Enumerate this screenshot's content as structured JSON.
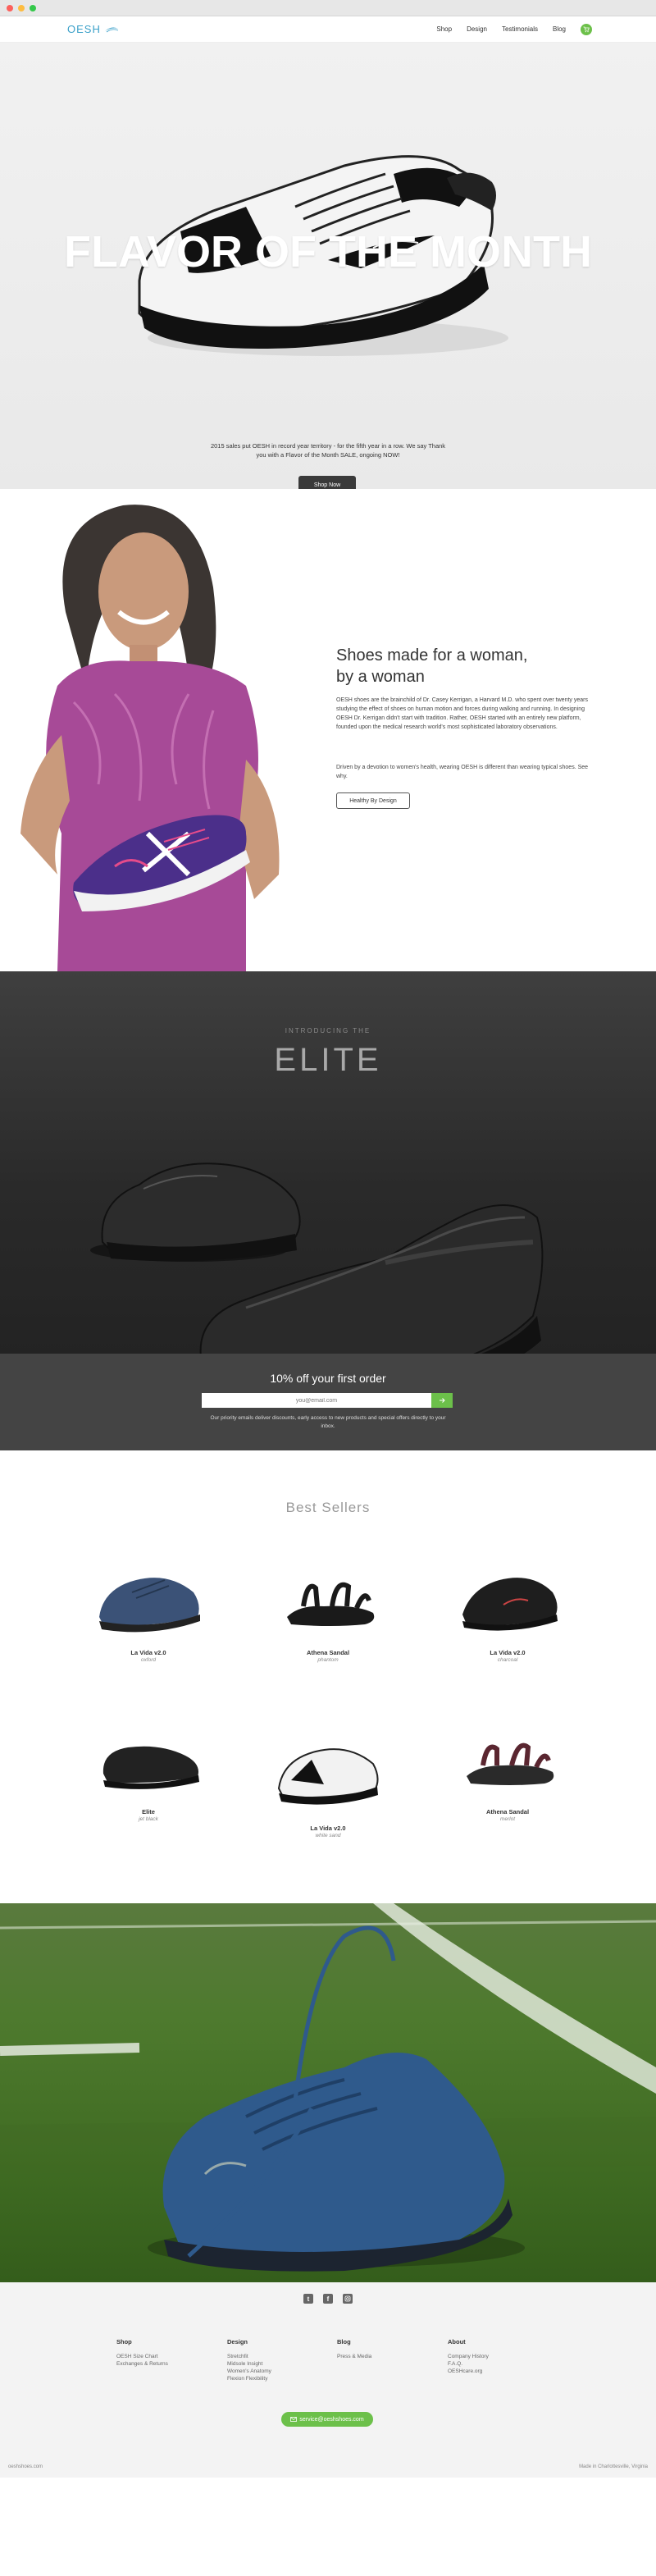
{
  "nav": {
    "logo": "OESH",
    "links": [
      "Shop",
      "Design",
      "Testimonials",
      "Blog"
    ]
  },
  "hero": {
    "title": "FLAVOR OF THE MONTH",
    "text_line1": "2015 sales put OESH in record year territory - for the fifth year in a row. We say Thank",
    "text_line2": "you with a Flavor of the Month SALE, ongoing NOW!",
    "button": "Shop Now"
  },
  "woman": {
    "heading_line1": "Shoes made for a woman,",
    "heading_line2": "by a woman",
    "para1": "OESH shoes are the brainchild of Dr. Casey Kerrigan, a Harvard M.D. who spent over twenty years studying the effect of shoes on human motion and forces during walking and running. In designing OESH Dr. Kerrigan didn't start with tradition. Rather, OESH started with an entirely new platform, founded upon the medical research world's most sophisticated laboratory observations.",
    "para2": "Driven by a devotion to women's health, wearing OESH is different than wearing typical shoes. See why.",
    "button": "Healthy By Design"
  },
  "elite": {
    "sub": "INTRODUCING THE",
    "title": "ELITE",
    "promo_title": "10% off your first order",
    "email_placeholder": "you@email.com",
    "promo_text": "Our priority emails deliver discounts, early access to new products and special offers directly to your inbox."
  },
  "best": {
    "title": "Best Sellers",
    "products": [
      {
        "name": "La Vida v2.0",
        "color": "oxford"
      },
      {
        "name": "Athena Sandal",
        "color": "phantom"
      },
      {
        "name": "La Vida v2.0",
        "color": "charcoal"
      },
      {
        "name": "Elite",
        "color": "jet black"
      },
      {
        "name": "La Vida v2.0",
        "color": "white sand"
      },
      {
        "name": "Athena Sandal",
        "color": "merlot"
      }
    ]
  },
  "footer": {
    "cols": [
      {
        "title": "Shop",
        "items": [
          "OESH Size Chart",
          "Exchanges & Returns"
        ]
      },
      {
        "title": "Design",
        "items": [
          "Stretchfit",
          "Midsole Insight",
          "Women's Anatomy",
          "Flexion Flexibility"
        ]
      },
      {
        "title": "Blog",
        "items": [
          "Press & Media"
        ]
      },
      {
        "title": "About",
        "items": [
          "Company History",
          "F.A.Q.",
          "OESHcare.org"
        ]
      }
    ],
    "email": "service@oeshshoes.com",
    "copy_left": "oeshshoes.com",
    "copy_right": "Made in Charlottesville, Virginia"
  },
  "colors": {
    "accent": "#6cc04a",
    "brand": "#3aa0c9"
  }
}
